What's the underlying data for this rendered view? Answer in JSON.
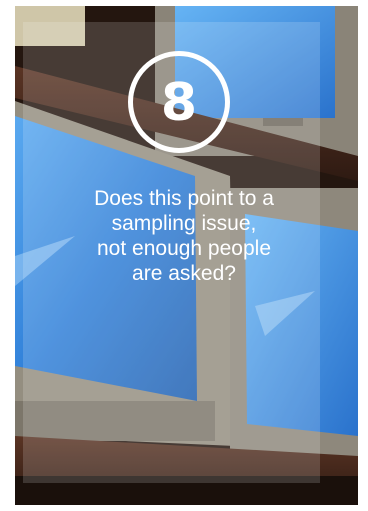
{
  "card": {
    "number": "8",
    "question_lines": [
      "Does this point to a",
      "sampling issue,",
      "not enough people",
      "are asked?"
    ]
  },
  "colors": {
    "text": "#ffffff",
    "screen_blue": "#3a8fe0",
    "frame_dark": "#2a1a14"
  }
}
